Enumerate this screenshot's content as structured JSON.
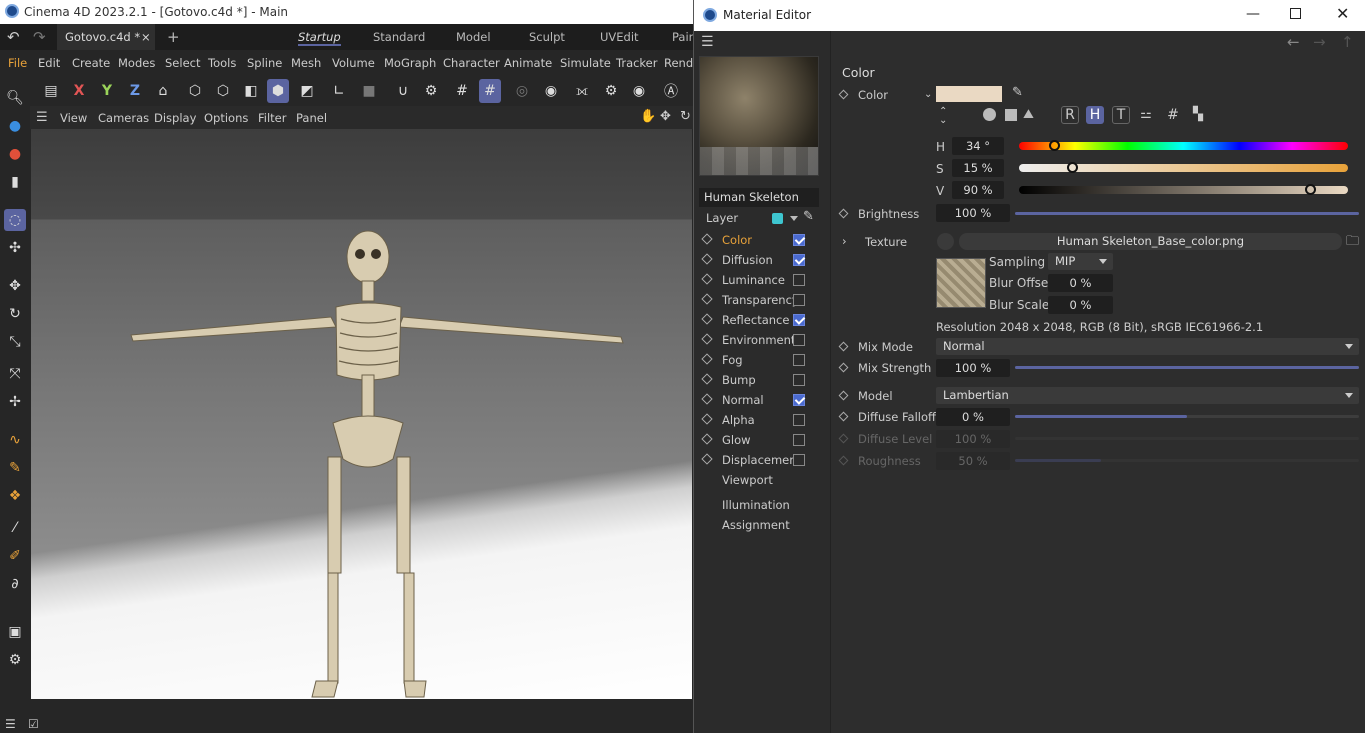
{
  "app": {
    "title": "Cinema 4D 2023.2.1 - [Gotovo.c4d *] - Main"
  },
  "tabs": {
    "doc": "Gotovo.c4d *",
    "close": "×",
    "add": "+",
    "layouts": [
      "Startup",
      "Standard",
      "Model",
      "Sculpt",
      "UVEdit",
      "Pain"
    ]
  },
  "menu": [
    "File",
    "Edit",
    "Create",
    "Modes",
    "Select",
    "Tools",
    "Spline",
    "Mesh",
    "Volume",
    "MoGraph",
    "Character",
    "Animate",
    "Simulate",
    "Tracker",
    "Rende"
  ],
  "toolbar": {
    "x": "X",
    "y": "Y",
    "z": "Z"
  },
  "viewport": {
    "menu": [
      "View",
      "Cameras",
      "Display",
      "Options",
      "Filter",
      "Panel"
    ]
  },
  "me": {
    "title": "Material Editor",
    "name": "Human Skeleton",
    "layer": "Layer",
    "layer_color": "#3ec6d0",
    "channels": [
      {
        "label": "Color",
        "checked": true,
        "active": true
      },
      {
        "label": "Diffusion",
        "checked": true
      },
      {
        "label": "Luminance",
        "checked": false
      },
      {
        "label": "Transparency",
        "checked": false
      },
      {
        "label": "Reflectance",
        "checked": true
      },
      {
        "label": "Environment",
        "checked": false
      },
      {
        "label": "Fog",
        "checked": false
      },
      {
        "label": "Bump",
        "checked": false
      },
      {
        "label": "Normal",
        "checked": true
      },
      {
        "label": "Alpha",
        "checked": false
      },
      {
        "label": "Glow",
        "checked": false
      },
      {
        "label": "Displacement",
        "checked": false
      }
    ],
    "extra": [
      "Viewport",
      "Illumination",
      "Assignment"
    ],
    "section": "Color",
    "color_label": "Color",
    "swatch": "#ead9c3",
    "mode_buttons": [
      "R",
      "H",
      "T"
    ],
    "h": {
      "label": "H",
      "value": "34 °",
      "pos": 0.094
    },
    "s": {
      "label": "S",
      "value": "15 %",
      "pos": 0.15
    },
    "v": {
      "label": "V",
      "value": "90 %",
      "pos": 0.9
    },
    "brightness": {
      "label": "Brightness",
      "value": "100 %",
      "pos": 1.0
    },
    "texture": {
      "label": "Texture",
      "file": "Human Skeleton_Base_color.png"
    },
    "sampling": {
      "label": "Sampling",
      "value": "MIP"
    },
    "blur_offset": {
      "label": "Blur Offset",
      "value": "0 %"
    },
    "blur_scale": {
      "label": "Blur Scale",
      "value": "0 %"
    },
    "resolution": "Resolution 2048 x 2048, RGB (8 Bit), sRGB IEC61966-2.1",
    "mix_mode": {
      "label": "Mix Mode",
      "value": "Normal"
    },
    "mix_strength": {
      "label": "Mix Strength",
      "value": "100 %",
      "pos": 1.0
    },
    "model": {
      "label": "Model",
      "value": "Lambertian"
    },
    "diffuse_falloff": {
      "label": "Diffuse Falloff",
      "value": "0 %",
      "pos": 0.5
    },
    "diffuse_level": {
      "label": "Diffuse Level",
      "value": "100 %"
    },
    "roughness": {
      "label": "Roughness",
      "value": "50 %"
    }
  },
  "colors": {
    "accent": "#5b64a0",
    "active_channel": "#e8a23a",
    "check": "#4a6ad0"
  }
}
